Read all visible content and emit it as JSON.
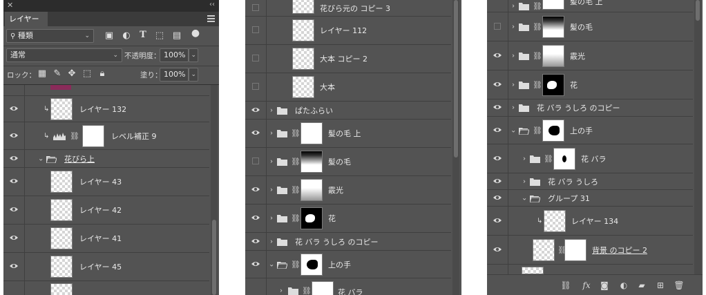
{
  "panel1": {
    "tab_title": "レイヤー",
    "filter_label": "種類",
    "blend_mode": "通常",
    "opacity_label": "不透明度：",
    "opacity_value": "100%",
    "lock_label": "ロック：",
    "fill_label": "塗り：",
    "fill_value": "100%",
    "layers": [
      {
        "name": "",
        "type": "partial"
      },
      {
        "name": "レイヤー 132",
        "type": "layer"
      },
      {
        "name": "レベル補正 9",
        "type": "adjustment"
      },
      {
        "name": "花びら上",
        "type": "group"
      },
      {
        "name": "レイヤー 43",
        "type": "layer"
      },
      {
        "name": "レイヤー 42",
        "type": "layer"
      },
      {
        "name": "レイヤー 41",
        "type": "layer"
      },
      {
        "name": "レイヤー 45",
        "type": "layer"
      }
    ]
  },
  "panel2": {
    "layers": [
      {
        "name": "花びら元の コピー 3"
      },
      {
        "name": "レイヤー 112"
      },
      {
        "name": "大本 コピー 2"
      },
      {
        "name": "大本"
      },
      {
        "name": "ぱたふらい"
      },
      {
        "name": "髪の毛 上"
      },
      {
        "name": "髪の毛"
      },
      {
        "name": "霰光"
      },
      {
        "name": "花"
      },
      {
        "name": "花 バラ うしろ のコピー"
      },
      {
        "name": "上の手"
      },
      {
        "name": "花 バラ"
      }
    ]
  },
  "panel3": {
    "layers": [
      {
        "name": "髪の毛 上"
      },
      {
        "name": "髪の毛"
      },
      {
        "name": "霰光"
      },
      {
        "name": "花"
      },
      {
        "name": "花 バラ うしろ のコピー"
      },
      {
        "name": "上の手"
      },
      {
        "name": "花 バラ"
      },
      {
        "name": "花 バラ うしろ"
      },
      {
        "name": "グループ 31"
      },
      {
        "name": "レイヤー 134"
      },
      {
        "name": "背景 のコピー 2"
      }
    ],
    "bottom_icons": [
      "link-icon",
      "fx-icon",
      "mask-icon",
      "adjustment-icon",
      "folder-icon",
      "new-layer-icon",
      "trash-icon"
    ],
    "fx_label": "fx"
  },
  "colors": {
    "panel_bg": "#535353",
    "dark_bar": "#2c2c2c",
    "swatch": "#8a2b5a"
  }
}
